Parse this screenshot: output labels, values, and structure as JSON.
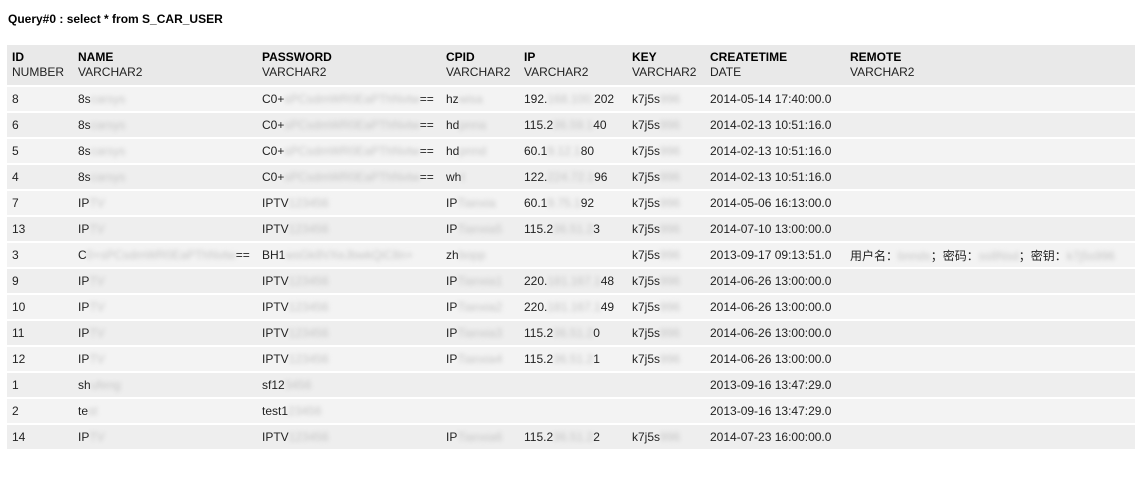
{
  "query_title": "Query#0 : select * from S_CAR_USER",
  "columns": [
    {
      "name": "ID",
      "type": "NUMBER"
    },
    {
      "name": "NAME",
      "type": "VARCHAR2"
    },
    {
      "name": "PASSWORD",
      "type": "VARCHAR2"
    },
    {
      "name": "CPID",
      "type": "VARCHAR2"
    },
    {
      "name": "IP",
      "type": "VARCHAR2"
    },
    {
      "name": "KEY",
      "type": "VARCHAR2"
    },
    {
      "name": "CREATETIME",
      "type": "DATE"
    },
    {
      "name": "REMOTE",
      "type": "VARCHAR2"
    }
  ],
  "rows": [
    {
      "id": "8",
      "name": "8s",
      "name_blur": "carsys",
      "password": "C0+",
      "password_blur": "sPCsdmWR0EaPThNvtw",
      "password_tail": "==",
      "cpid": "hz",
      "cpid_blur": "wisa",
      "ip": "192.",
      "ip_blur": "168.100.",
      "ip_tail": "202",
      "key": "k7j5s",
      "key_blur": "996",
      "createtime": "2014-05-14 17:40:00.0",
      "remote": ""
    },
    {
      "id": "6",
      "name": "8s",
      "name_blur": "carsys",
      "password": "C0+",
      "password_blur": "sPCsdmWR0EaPThNvtw",
      "password_tail": "==",
      "cpid": "hd",
      "cpid_blur": "pnna",
      "ip": "115.2",
      "ip_blur": "36.59.1",
      "ip_tail": "40",
      "key": "k7j5s",
      "key_blur": "996",
      "createtime": "2014-02-13 10:51:16.0",
      "remote": ""
    },
    {
      "id": "5",
      "name": "8s",
      "name_blur": "carsys",
      "password": "C0+",
      "password_blur": "sPCsdmWR0EaPThNvtw",
      "password_tail": "==",
      "cpid": "hd",
      "cpid_blur": "pnnd",
      "ip": "60.1",
      "ip_blur": "9.12.1",
      "ip_tail": "80",
      "key": "k7j5s",
      "key_blur": "996",
      "createtime": "2014-02-13 10:51:16.0",
      "remote": ""
    },
    {
      "id": "4",
      "name": "8s",
      "name_blur": "carsys",
      "password": "C0+",
      "password_blur": "sPCsdmWR0EaPThNvtw",
      "password_tail": "==",
      "cpid": "wh",
      "cpid_blur": "t",
      "ip": "122.",
      "ip_blur": "224.72.1",
      "ip_tail": "96",
      "key": "k7j5s",
      "key_blur": "996",
      "createtime": "2014-02-13 10:51:16.0",
      "remote": ""
    },
    {
      "id": "7",
      "name": "IP",
      "name_blur": "TV",
      "password": "IPTV",
      "password_blur": "123456",
      "password_tail": "",
      "cpid": "IP",
      "cpid_blur": "Tianxia",
      "ip": "60.1",
      "ip_blur": "9.75.1",
      "ip_tail": "92",
      "key": "k7j5s",
      "key_blur": "996",
      "createtime": "2014-05-06 16:13:00.0",
      "remote": ""
    },
    {
      "id": "13",
      "name": "IP",
      "name_blur": "TV",
      "password": "IPTV",
      "password_blur": "123456",
      "password_tail": "",
      "cpid": "IP",
      "cpid_blur": "Tianxia5",
      "ip": "115.2",
      "ip_blur": "36.51.2",
      "ip_tail": "3",
      "key": "k7j5s",
      "key_blur": "996",
      "createtime": "2014-07-10 13:00:00.0",
      "remote": ""
    },
    {
      "id": "3",
      "name": "C",
      "name_blur": "0+sPCsdmWR0EaPThNvtw",
      "name_tail": "==",
      "password": "BH1",
      "password_blur": "wsGk8VXeJbwkQiC8n+",
      "password_tail": "",
      "cpid": "zh",
      "cpid_blur": "bopp",
      "ip": "",
      "ip_blur": "",
      "ip_tail": "",
      "key": "k7j5s",
      "key_blur": "996",
      "createtime": "2013-09-17 09:13:51.0",
      "remote": "用户名：",
      "remote_blur1": "bnnds",
      "remote_mid1": "；密码：",
      "remote_blur2": "ss8Nsd",
      "remote_mid2": "；密钥：",
      "remote_blur3": "k7j5s996"
    },
    {
      "id": "9",
      "name": "IP",
      "name_blur": "TV",
      "password": "IPTV",
      "password_blur": "123456",
      "password_tail": "",
      "cpid": "IP",
      "cpid_blur": "Tianxia1",
      "ip": "220.",
      "ip_blur": "181.167.1",
      "ip_tail": "48",
      "key": "k7j5s",
      "key_blur": "996",
      "createtime": "2014-06-26 13:00:00.0",
      "remote": ""
    },
    {
      "id": "10",
      "name": "IP",
      "name_blur": "TV",
      "password": "IPTV",
      "password_blur": "123456",
      "password_tail": "",
      "cpid": "IP",
      "cpid_blur": "Tianxia2",
      "ip": "220.",
      "ip_blur": "181.167.1",
      "ip_tail": "49",
      "key": "k7j5s",
      "key_blur": "996",
      "createtime": "2014-06-26 13:00:00.0",
      "remote": ""
    },
    {
      "id": "11",
      "name": "IP",
      "name_blur": "TV",
      "password": "IPTV",
      "password_blur": "123456",
      "password_tail": "",
      "cpid": "IP",
      "cpid_blur": "Tianxia3",
      "ip": "115.2",
      "ip_blur": "36.51.2",
      "ip_tail": "0",
      "key": "k7j5s",
      "key_blur": "996",
      "createtime": "2014-06-26 13:00:00.0",
      "remote": ""
    },
    {
      "id": "12",
      "name": "IP",
      "name_blur": "TV",
      "password": "IPTV",
      "password_blur": "123456",
      "password_tail": "",
      "cpid": "IP",
      "cpid_blur": "Tianxia4",
      "ip": "115.2",
      "ip_blur": "36.51.2",
      "ip_tail": "1",
      "key": "k7j5s",
      "key_blur": "996",
      "createtime": "2014-06-26 13:00:00.0",
      "remote": ""
    },
    {
      "id": "1",
      "name": "sh",
      "name_blur": "ufeng",
      "password": "sf12",
      "password_blur": "3456",
      "password_tail": "",
      "cpid": "",
      "cpid_blur": "",
      "ip": "",
      "ip_blur": "",
      "ip_tail": "",
      "key": "",
      "key_blur": "",
      "createtime": "2013-09-16 13:47:29.0",
      "remote": ""
    },
    {
      "id": "2",
      "name": "te",
      "name_blur": "st",
      "password": "test1",
      "password_blur": "23456",
      "password_tail": "",
      "cpid": "",
      "cpid_blur": "",
      "ip": "",
      "ip_blur": "",
      "ip_tail": "",
      "key": "",
      "key_blur": "",
      "createtime": "2013-09-16 13:47:29.0",
      "remote": ""
    },
    {
      "id": "14",
      "name": "IP",
      "name_blur": "TV",
      "password": "IPTV",
      "password_blur": "123456",
      "password_tail": "",
      "cpid": "IP",
      "cpid_blur": "Tianxia6",
      "ip": "115.2",
      "ip_blur": "36.51.2",
      "ip_tail": "2",
      "key": "k7j5s",
      "key_blur": "996",
      "createtime": "2014-07-23 16:00:00.0",
      "remote": ""
    }
  ]
}
